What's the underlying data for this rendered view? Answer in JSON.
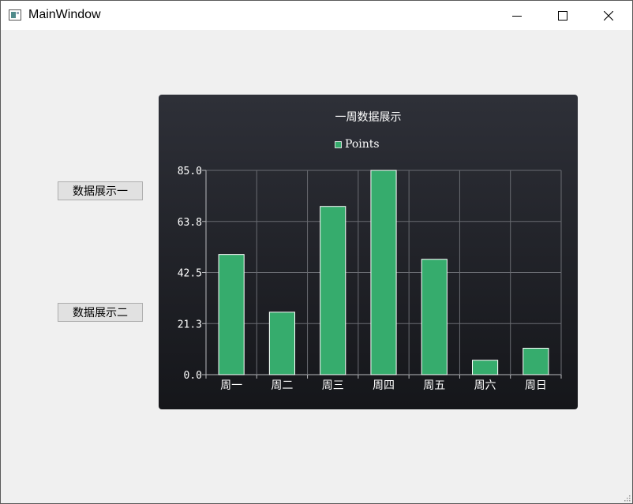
{
  "window": {
    "title": "MainWindow",
    "controls": {
      "minimize": "minimize-icon",
      "maximize": "maximize-icon",
      "close": "close-icon"
    }
  },
  "sidebar": {
    "buttons": [
      {
        "label": "数据展示一"
      },
      {
        "label": "数据展示二"
      }
    ]
  },
  "colors": {
    "bar": "#36ac6d",
    "chart_bg_top": "#2e3038",
    "chart_bg_bottom": "#15161a",
    "grid": "#6a6c72",
    "text": "#ffffff"
  },
  "chart_data": {
    "type": "bar",
    "title": "一周数据展示",
    "categories": [
      "周一",
      "周二",
      "周三",
      "周四",
      "周五",
      "周六",
      "周日"
    ],
    "series": [
      {
        "name": "Points",
        "values": [
          50,
          26,
          70,
          85,
          48,
          6,
          11
        ]
      }
    ],
    "ylim": [
      0,
      85
    ],
    "yticks": [
      "0.0",
      "21.3",
      "42.5",
      "63.8",
      "85.0"
    ],
    "grid": true,
    "legend": "top-center"
  }
}
